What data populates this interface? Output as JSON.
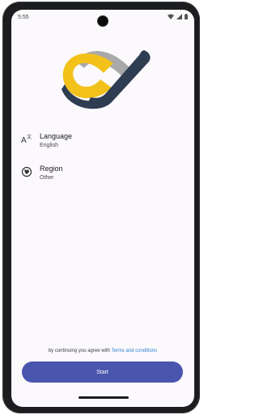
{
  "statusbar": {
    "time": "5:55"
  },
  "settings": [
    {
      "title": "Language",
      "value": "English",
      "icon": "translate-icon"
    },
    {
      "title": "Region",
      "value": "Other",
      "icon": "globe-icon"
    }
  ],
  "consent": {
    "text": "by continuing you agree with ",
    "link": "Terms and conditions"
  },
  "start_button": {
    "label": "Start"
  },
  "colors": {
    "accent": "#4a55ae",
    "link": "#2f7fd1",
    "logo_yellow": "#f2c21b",
    "logo_navy": "#2f3d52",
    "logo_gray": "#a9a9a9"
  }
}
